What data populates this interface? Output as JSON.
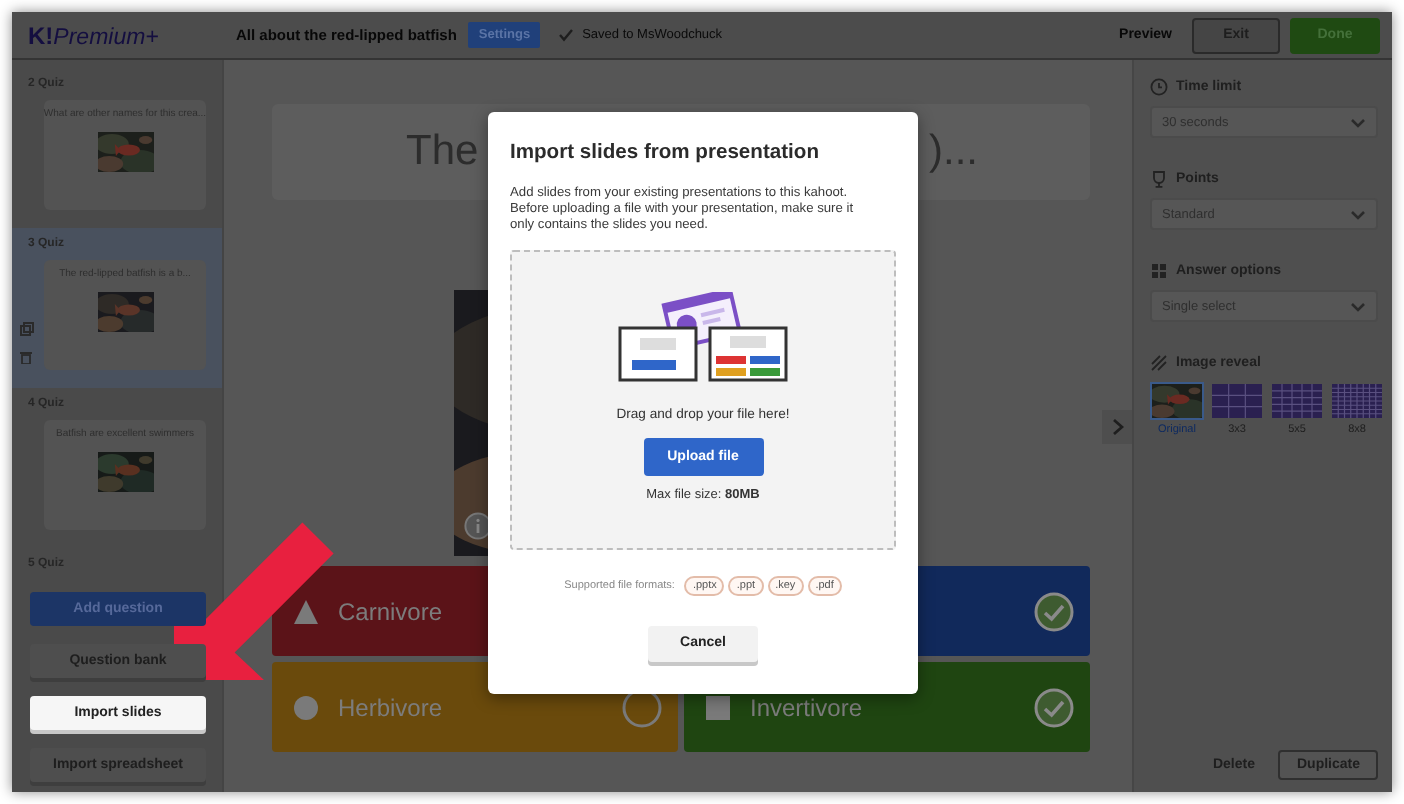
{
  "header": {
    "logo_mark": "K!",
    "logo_text": "Premium+",
    "title": "All about the red-lipped batfish",
    "settings_button": "Settings",
    "save_status": "Saved to MsWoodchuck",
    "preview_button": "Preview",
    "exit_button": "Exit",
    "done_button": "Done"
  },
  "slides": [
    {
      "number": "2",
      "type": "Quiz",
      "question": "What are other names for this crea...",
      "selected": false
    },
    {
      "number": "3",
      "type": "Quiz",
      "question": "The red-lipped batfish is a b...",
      "selected": true
    },
    {
      "number": "4",
      "type": "Quiz",
      "question": "Batfish are excellent swimmers",
      "selected": false
    },
    {
      "number": "5",
      "type": "Quiz",
      "selected": false
    }
  ],
  "sidebar_buttons": [
    {
      "label": "Add question",
      "kind": "primary",
      "highlighted": false
    },
    {
      "label": "Question bank",
      "kind": "secondary",
      "highlighted": false
    },
    {
      "label": "Import slides",
      "kind": "secondary",
      "highlighted": true
    },
    {
      "label": "Import spreadsheet",
      "kind": "secondary",
      "highlighted": false
    }
  ],
  "question": {
    "title_start": "The",
    "title_end": ")..."
  },
  "answers": [
    {
      "kind": "triangle",
      "text": "Carnivore",
      "color": "#5b1318"
    },
    {
      "color": "#11295b",
      "correct": true
    },
    {
      "kind": "circle",
      "text": "Herbivore",
      "color": "#6a4a0c",
      "correct": false
    },
    {
      "kind": "square",
      "text": "Invertivore",
      "color": "#1f4511",
      "correct": true
    }
  ],
  "settings": {
    "fields": [
      {
        "kind": "time",
        "label": "Time limit",
        "value": "30 seconds"
      },
      {
        "kind": "points",
        "label": "Points",
        "value": "Standard"
      },
      {
        "kind": "answers",
        "label": "Answer options",
        "value": "Single select"
      }
    ],
    "image_reveal": {
      "label": "Image reveal",
      "options": [
        {
          "label": "Original",
          "selected": true
        },
        {
          "label": "3x3",
          "selected": false
        },
        {
          "label": "5x5",
          "selected": false
        },
        {
          "label": "8x8",
          "selected": false
        }
      ]
    },
    "delete_button": "Delete",
    "duplicate_button": "Duplicate"
  },
  "modal": {
    "title": "Import slides from presentation",
    "description": "Add slides from your existing presentations to this kahoot. Before uploading a file with your presentation, make sure it only contains the slides you need.",
    "drop_text": "Drag and drop your file here!",
    "upload_button": "Upload file",
    "max_size": "Max file size: **80MB**",
    "formats_label": "Supported file formats:",
    "formats": [
      ".pptx",
      ".ppt",
      ".key",
      ".pdf"
    ],
    "cancel_button": "Cancel"
  }
}
